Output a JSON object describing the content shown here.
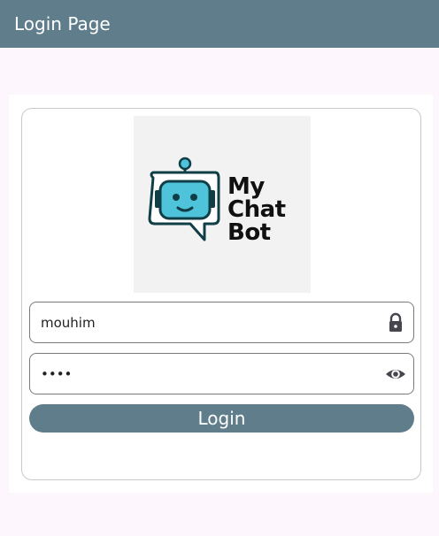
{
  "appbar": {
    "title": "Login Page",
    "color": "#607d8b"
  },
  "logo": {
    "line1": "My",
    "line2": "Chat",
    "line3": "Bot",
    "icon": "robot-chat-bubble-icon"
  },
  "form": {
    "username_value": "mouhim",
    "username_icon": "lock-icon",
    "password_value": "••••",
    "password_icon": "eye-icon",
    "login_label": "Login"
  },
  "colors": {
    "accent": "#607d8b",
    "background": "#fdf7fd",
    "robot_face": "#4fc3d9"
  }
}
